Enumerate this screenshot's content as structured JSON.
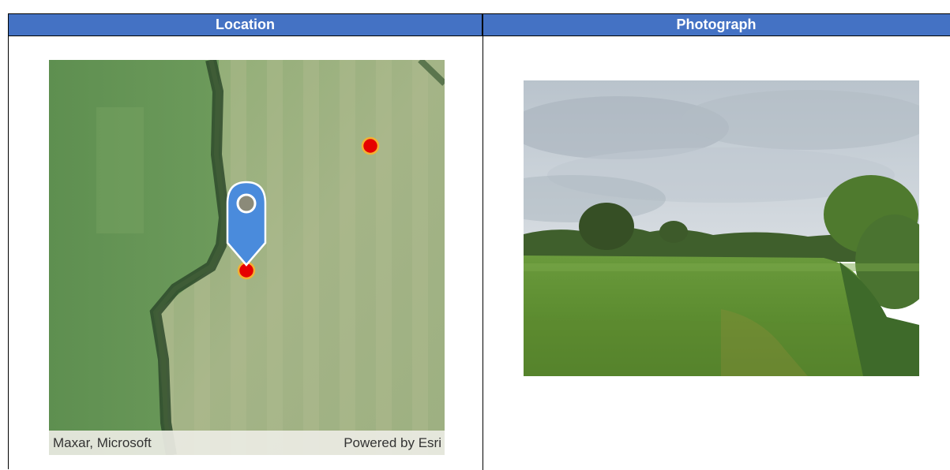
{
  "table": {
    "col_location": "Location",
    "col_photograph": "Photograph"
  },
  "map": {
    "attribution_left": "Maxar, Microsoft",
    "attribution_right": "Powered by Esri",
    "marker_color": "#4a8bdc",
    "point_color": "#e60000",
    "point_outline": "#f2b134"
  },
  "photo": {
    "description_icon": "landscape-photo"
  }
}
